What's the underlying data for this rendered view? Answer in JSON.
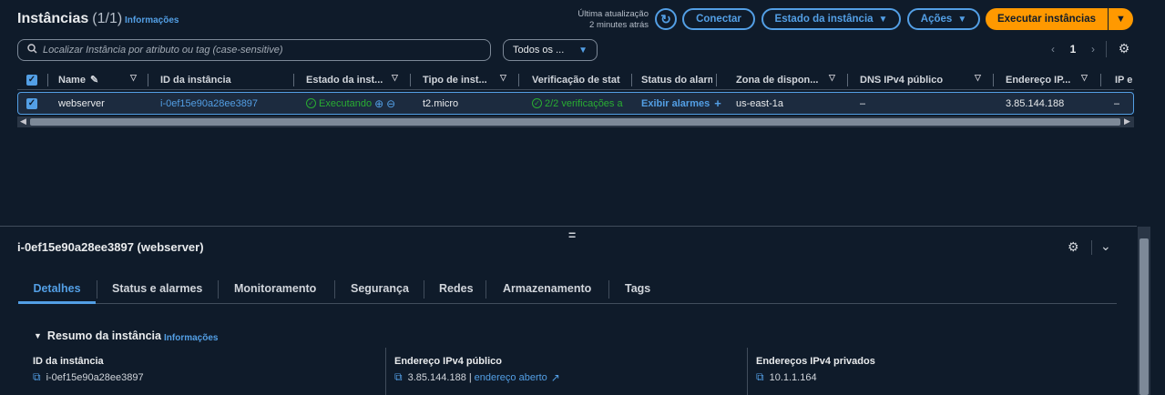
{
  "header": {
    "title": "Instâncias",
    "count": "(1/1)",
    "info_link": "Informações",
    "last_update_line1": "Última atualização",
    "last_update_line2": "2 minutes atrás",
    "connect_label": "Conectar",
    "instance_state_label": "Estado da instância",
    "actions_label": "Ações",
    "launch_label": "Executar instâncias"
  },
  "search": {
    "placeholder": "Localizar Instância por atributo ou tag (case-sensitive)"
  },
  "filter": {
    "selected": "Todos os ..."
  },
  "pagination": {
    "current_page": "1"
  },
  "table": {
    "columns": [
      "Name",
      "ID da instância",
      "Estado da inst...",
      "Tipo de inst...",
      "Verificação de stat",
      "Status do alarm",
      "Zona de dispon...",
      "DNS IPv4 público",
      "Endereço IP...",
      "IP e"
    ],
    "row": {
      "name": "webserver",
      "instance_id": "i-0ef15e90a28ee3897",
      "state": "Executando",
      "type": "t2.micro",
      "status_check": "2/2 verificações a",
      "alarm_status": "Exibir alarmes",
      "az": "us-east-1a",
      "dns": "–",
      "public_ip": "3.85.144.188",
      "ip_extra": "–"
    }
  },
  "detail": {
    "title": "i-0ef15e90a28ee3897 (webserver)",
    "tabs": [
      "Detalhes",
      "Status e alarmes",
      "Monitoramento",
      "Segurança",
      "Redes",
      "Armazenamento",
      "Tags"
    ],
    "summary_title": "Resumo da instância",
    "summary_info": "Informações",
    "fields": {
      "instance_id_label": "ID da instância",
      "instance_id_value": "i-0ef15e90a28ee3897",
      "public_ip_label": "Endereço IPv4 público",
      "public_ip_value": "3.85.144.188",
      "public_ip_sep": "|",
      "open_address": "endereço aberto",
      "private_ip_label": "Endereços IPv4 privados",
      "private_ip_value": "10.1.1.164"
    }
  },
  "colors": {
    "background": "#0f1b2a",
    "accent": "#539fe5",
    "primary_button": "#ff9900",
    "success": "#29ad32"
  }
}
